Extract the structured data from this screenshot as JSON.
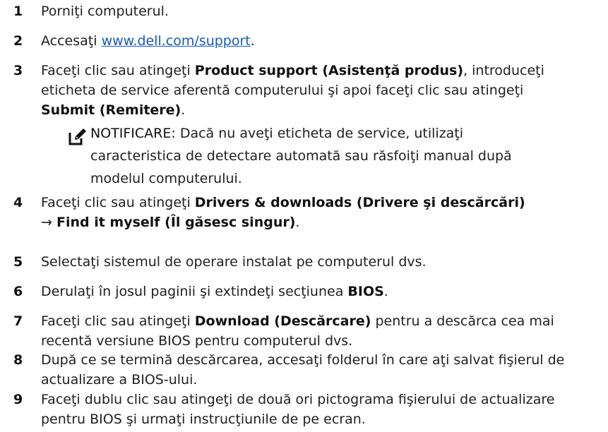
{
  "steps": [
    {
      "num": "1",
      "parts": [
        {
          "t": "Porniţi computerul."
        }
      ]
    },
    {
      "num": "2",
      "parts": [
        {
          "t": "Accesaţi "
        },
        {
          "t": "www.dell.com/support",
          "link": true
        },
        {
          "t": "."
        }
      ]
    },
    {
      "num": "3",
      "parts": [
        {
          "t": "Faceţi clic sau atingeţi "
        },
        {
          "t": "Product support (Asistenţă produs)",
          "bold": true
        },
        {
          "t": ", introduceţi eticheta de service aferentă computerului şi apoi faceţi clic sau atingeţi "
        },
        {
          "t": "Submit (Remitere)",
          "bold": true
        },
        {
          "t": "."
        }
      ]
    },
    {
      "num": "4",
      "parts": [
        {
          "t": "Faceţi clic sau atingeţi "
        },
        {
          "t": "Drivers & downloads (Drivere şi descărcări)",
          "bold": true
        },
        {
          "t": " → "
        },
        {
          "t": "Find it myself (Îl găsesc singur)",
          "bold": true
        },
        {
          "t": "."
        }
      ]
    },
    {
      "num": "5",
      "parts": [
        {
          "t": "Selectaţi sistemul de operare instalat pe computerul dvs."
        }
      ]
    },
    {
      "num": "6",
      "parts": [
        {
          "t": "Derulaţi în josul paginii şi extindeţi secţiunea "
        },
        {
          "t": "BIOS",
          "bold": true
        },
        {
          "t": "."
        }
      ]
    },
    {
      "num": "7",
      "parts": [
        {
          "t": "Faceţi clic sau atingeţi "
        },
        {
          "t": "Download (Descărcare)",
          "bold": true
        },
        {
          "t": " pentru a descărca cea mai recentă versiune BIOS pentru computerul dvs."
        }
      ]
    },
    {
      "num": "8",
      "parts": [
        {
          "t": "După ce se termină descărcarea, accesaţi folderul în care aţi salvat fişierul de actualizare a BIOS-ului."
        }
      ]
    },
    {
      "num": "9",
      "parts": [
        {
          "t": "Faceţi dublu clic sau atingeţi de două ori pictograma fişierului de actualizare pentru BIOS şi urmaţi instrucţiunile de pe ecran."
        }
      ]
    }
  ],
  "note": {
    "label": "NOTIFICARE:",
    "text": " Dacă nu aveţi eticheta de service, utilizaţi caracteristica de detectare automată sau răsfoiţi manual după modelul computerului.",
    "icon": "pencil-note-icon"
  }
}
